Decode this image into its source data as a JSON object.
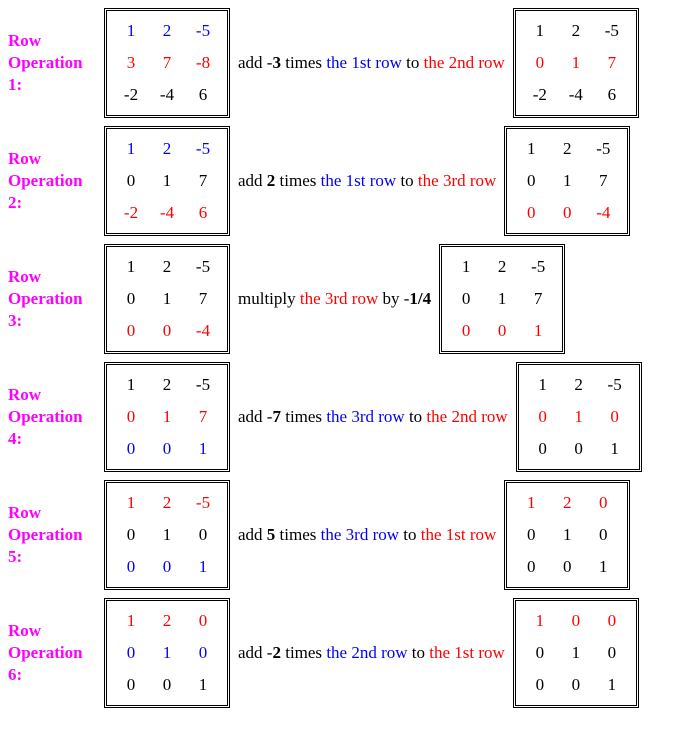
{
  "chart_data": {
    "type": "table",
    "title": "Gaussian elimination row operations",
    "steps": [
      {
        "label": "Row Operation 1:",
        "before": [
          [
            1,
            2,
            -5
          ],
          [
            3,
            7,
            -8
          ],
          [
            -2,
            -4,
            6
          ]
        ],
        "op": "add -3 times the 1st row to the 2nd row",
        "after": [
          [
            1,
            2,
            -5
          ],
          [
            0,
            1,
            7
          ],
          [
            -2,
            -4,
            6
          ]
        ]
      },
      {
        "label": "Row Operation 2:",
        "before": [
          [
            1,
            2,
            -5
          ],
          [
            0,
            1,
            7
          ],
          [
            -2,
            -4,
            6
          ]
        ],
        "op": "add 2 times the 1st row to the 3rd row",
        "after": [
          [
            1,
            2,
            -5
          ],
          [
            0,
            1,
            7
          ],
          [
            0,
            0,
            -4
          ]
        ]
      },
      {
        "label": "Row Operation 3:",
        "before": [
          [
            1,
            2,
            -5
          ],
          [
            0,
            1,
            7
          ],
          [
            0,
            0,
            -4
          ]
        ],
        "op": "multiply the 3rd row by -1/4",
        "after": [
          [
            1,
            2,
            -5
          ],
          [
            0,
            1,
            7
          ],
          [
            0,
            0,
            1
          ]
        ]
      },
      {
        "label": "Row Operation 4:",
        "before": [
          [
            1,
            2,
            -5
          ],
          [
            0,
            1,
            7
          ],
          [
            0,
            0,
            1
          ]
        ],
        "op": "add -7 times the 3rd row to the 2nd row",
        "after": [
          [
            1,
            2,
            -5
          ],
          [
            0,
            1,
            0
          ],
          [
            0,
            0,
            1
          ]
        ]
      },
      {
        "label": "Row Operation 5:",
        "before": [
          [
            1,
            2,
            -5
          ],
          [
            0,
            1,
            0
          ],
          [
            0,
            0,
            1
          ]
        ],
        "op": "add 5 times the 3rd row to the 1st row",
        "after": [
          [
            1,
            2,
            0
          ],
          [
            0,
            1,
            0
          ],
          [
            0,
            0,
            1
          ]
        ]
      },
      {
        "label": "Row Operation 6:",
        "before": [
          [
            1,
            2,
            0
          ],
          [
            0,
            1,
            0
          ],
          [
            0,
            0,
            1
          ]
        ],
        "op": "add -2 times the 2nd row to the 1st row",
        "after": [
          [
            1,
            0,
            0
          ],
          [
            0,
            1,
            0
          ],
          [
            0,
            0,
            1
          ]
        ]
      }
    ]
  },
  "ops": [
    {
      "label": "Row Operation 1:",
      "ma": [
        [
          "1",
          "2",
          "-5"
        ],
        [
          "3",
          "7",
          "-8"
        ],
        [
          "-2",
          "-4",
          "6"
        ]
      ],
      "ca": [
        [
          "blue",
          "blue",
          "blue"
        ],
        [
          "red",
          "red",
          "red"
        ],
        [
          "",
          "",
          ""
        ]
      ],
      "desc": [
        [
          "",
          "add -"
        ],
        [
          "b",
          "3"
        ],
        [
          "",
          " times "
        ],
        [
          "blue",
          "the 1st row"
        ],
        [
          "",
          " to "
        ],
        [
          "red",
          "the 2nd row"
        ]
      ],
      "mb": [
        [
          "1",
          "2",
          "-5"
        ],
        [
          "0",
          "1",
          "7"
        ],
        [
          "-2",
          "-4",
          "6"
        ]
      ],
      "cb": [
        [
          "",
          "",
          ""
        ],
        [
          "red",
          "red",
          "red"
        ],
        [
          "",
          "",
          ""
        ]
      ]
    },
    {
      "label": "Row Operation 2:",
      "ma": [
        [
          "1",
          "2",
          "-5"
        ],
        [
          "0",
          "1",
          "7"
        ],
        [
          "-2",
          "-4",
          "6"
        ]
      ],
      "ca": [
        [
          "blue",
          "blue",
          "blue"
        ],
        [
          "",
          "",
          ""
        ],
        [
          "red",
          "red",
          "red"
        ]
      ],
      "desc": [
        [
          "",
          "add "
        ],
        [
          "b",
          "2"
        ],
        [
          "",
          " times "
        ],
        [
          "blue",
          "the 1st row"
        ],
        [
          "",
          " to "
        ],
        [
          "red",
          "the 3rd row"
        ]
      ],
      "mb": [
        [
          "1",
          "2",
          "-5"
        ],
        [
          "0",
          "1",
          "7"
        ],
        [
          "0",
          "0",
          "-4"
        ]
      ],
      "cb": [
        [
          "",
          "",
          ""
        ],
        [
          "",
          "",
          ""
        ],
        [
          "red",
          "red",
          "red"
        ]
      ]
    },
    {
      "label": "Row Operation 3:",
      "ma": [
        [
          "1",
          "2",
          "-5"
        ],
        [
          "0",
          "1",
          "7"
        ],
        [
          "0",
          "0",
          "-4"
        ]
      ],
      "ca": [
        [
          "",
          "",
          ""
        ],
        [
          "",
          "",
          ""
        ],
        [
          "red",
          "red",
          "red"
        ]
      ],
      "desc": [
        [
          "",
          "multiply "
        ],
        [
          "red",
          "the 3rd row"
        ],
        [
          "",
          " by -"
        ],
        [
          "b",
          "1/4"
        ]
      ],
      "mb": [
        [
          "1",
          "2",
          "-5"
        ],
        [
          "0",
          "1",
          "7"
        ],
        [
          "0",
          "0",
          "1"
        ]
      ],
      "cb": [
        [
          "",
          "",
          ""
        ],
        [
          "",
          "",
          ""
        ],
        [
          "red",
          "red",
          "red"
        ]
      ]
    },
    {
      "label": "Row Operation 4:",
      "ma": [
        [
          "1",
          "2",
          "-5"
        ],
        [
          "0",
          "1",
          "7"
        ],
        [
          "0",
          "0",
          "1"
        ]
      ],
      "ca": [
        [
          "",
          "",
          ""
        ],
        [
          "red",
          "red",
          "red"
        ],
        [
          "blue",
          "blue",
          "blue"
        ]
      ],
      "desc": [
        [
          "",
          "add -"
        ],
        [
          "b",
          "7"
        ],
        [
          "",
          " times "
        ],
        [
          "blue",
          "the 3rd row"
        ],
        [
          "",
          " to "
        ],
        [
          "red",
          "the 2nd row"
        ]
      ],
      "mb": [
        [
          "1",
          "2",
          "-5"
        ],
        [
          "0",
          "1",
          "0"
        ],
        [
          "0",
          "0",
          "1"
        ]
      ],
      "cb": [
        [
          "",
          "",
          ""
        ],
        [
          "red",
          "red",
          "red"
        ],
        [
          "",
          "",
          ""
        ]
      ]
    },
    {
      "label": "Row Operation 5:",
      "ma": [
        [
          "1",
          "2",
          "-5"
        ],
        [
          "0",
          "1",
          "0"
        ],
        [
          "0",
          "0",
          "1"
        ]
      ],
      "ca": [
        [
          "red",
          "red",
          "red"
        ],
        [
          "",
          "",
          ""
        ],
        [
          "blue",
          "blue",
          "blue"
        ]
      ],
      "desc": [
        [
          "",
          "add "
        ],
        [
          "b",
          "5"
        ],
        [
          "",
          " times "
        ],
        [
          "blue",
          "the 3rd row"
        ],
        [
          "",
          " to "
        ],
        [
          "red",
          "the 1st row"
        ]
      ],
      "mb": [
        [
          "1",
          "2",
          "0"
        ],
        [
          "0",
          "1",
          "0"
        ],
        [
          "0",
          "0",
          "1"
        ]
      ],
      "cb": [
        [
          "red",
          "red",
          "red"
        ],
        [
          "",
          "",
          ""
        ],
        [
          "",
          "",
          ""
        ]
      ]
    },
    {
      "label": "Row Operation 6:",
      "ma": [
        [
          "1",
          "2",
          "0"
        ],
        [
          "0",
          "1",
          "0"
        ],
        [
          "0",
          "0",
          "1"
        ]
      ],
      "ca": [
        [
          "red",
          "red",
          "red"
        ],
        [
          "blue",
          "blue",
          "blue"
        ],
        [
          "",
          "",
          ""
        ]
      ],
      "desc": [
        [
          "",
          "add -"
        ],
        [
          "b",
          "2"
        ],
        [
          "",
          " times "
        ],
        [
          "blue",
          "the 2nd row"
        ],
        [
          "",
          " to "
        ],
        [
          "red",
          "the 1st row"
        ]
      ],
      "mb": [
        [
          "1",
          "0",
          "0"
        ],
        [
          "0",
          "1",
          "0"
        ],
        [
          "0",
          "0",
          "1"
        ]
      ],
      "cb": [
        [
          "red",
          "red",
          "red"
        ],
        [
          "",
          "",
          ""
        ],
        [
          "",
          "",
          ""
        ]
      ]
    }
  ]
}
